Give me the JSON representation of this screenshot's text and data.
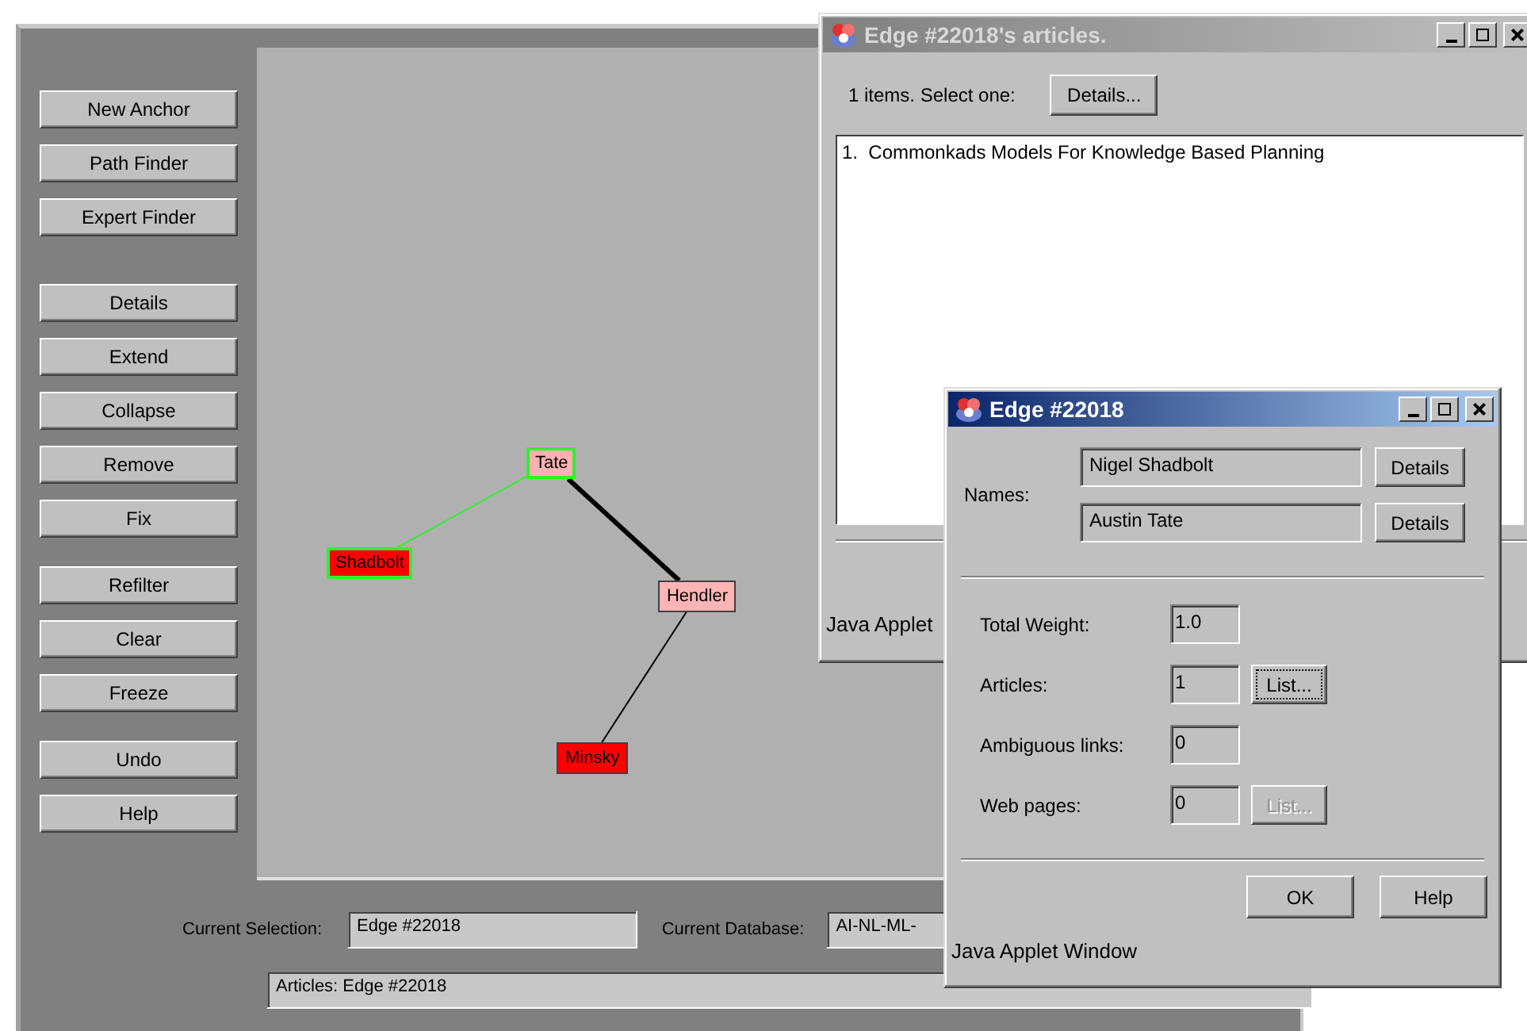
{
  "main_window": {
    "button_groups": [
      [
        "New Anchor",
        "Path Finder",
        "Expert Finder"
      ],
      [
        "Details",
        "Extend",
        "Collapse",
        "Remove",
        "Fix"
      ],
      [
        "Refilter",
        "Clear",
        "Freeze"
      ],
      [
        "Undo",
        "Help"
      ]
    ],
    "graph": {
      "nodes": [
        {
          "label": "Tate",
          "color": "#ffb0b0",
          "highlighted": true
        },
        {
          "label": "Shadbolt",
          "color": "#ff0000",
          "highlighted": true
        },
        {
          "label": "Hendler",
          "color": "#ffb4b4",
          "highlighted": false
        },
        {
          "label": "Minsky",
          "color": "#ff0000",
          "highlighted": false
        }
      ],
      "edges": [
        {
          "kind": "selected"
        },
        {
          "kind": "heavy"
        },
        {
          "kind": "light"
        }
      ]
    },
    "current_selection": {
      "label": "Current Selection:",
      "value": "Edge #22018"
    },
    "current_database": {
      "label": "Current Database:",
      "value": "AI-NL-ML-"
    },
    "status": "Articles: Edge #22018"
  },
  "articles_window": {
    "title": "Edge #22018's articles.",
    "active": false,
    "prompt": "1 items. Select one:",
    "details_button": "Details...",
    "items": [
      {
        "label": "1.  Commonkads Models For Knowledge Based Planning",
        "selected": false
      }
    ],
    "footer": "Java Applet"
  },
  "edge_dialog": {
    "title": "Edge #22018",
    "active": true,
    "names_label": "Names:",
    "names": [
      {
        "value": "Nigel Shadbolt",
        "button": "Details"
      },
      {
        "value": "Austin Tate",
        "button": "Details"
      }
    ],
    "fields": [
      {
        "label": "Total Weight:",
        "value": "1.0"
      },
      {
        "label": "Articles:",
        "value": "1",
        "button": {
          "label": "List...",
          "disabled": false,
          "focused": true
        }
      },
      {
        "label": "Ambiguous links:",
        "value": "0"
      },
      {
        "label": "Web pages:",
        "value": "0",
        "button": {
          "label": "List...",
          "disabled": true,
          "focused": false
        }
      }
    ],
    "buttons": [
      "OK",
      "Help"
    ],
    "footer": "Java Applet Window"
  }
}
